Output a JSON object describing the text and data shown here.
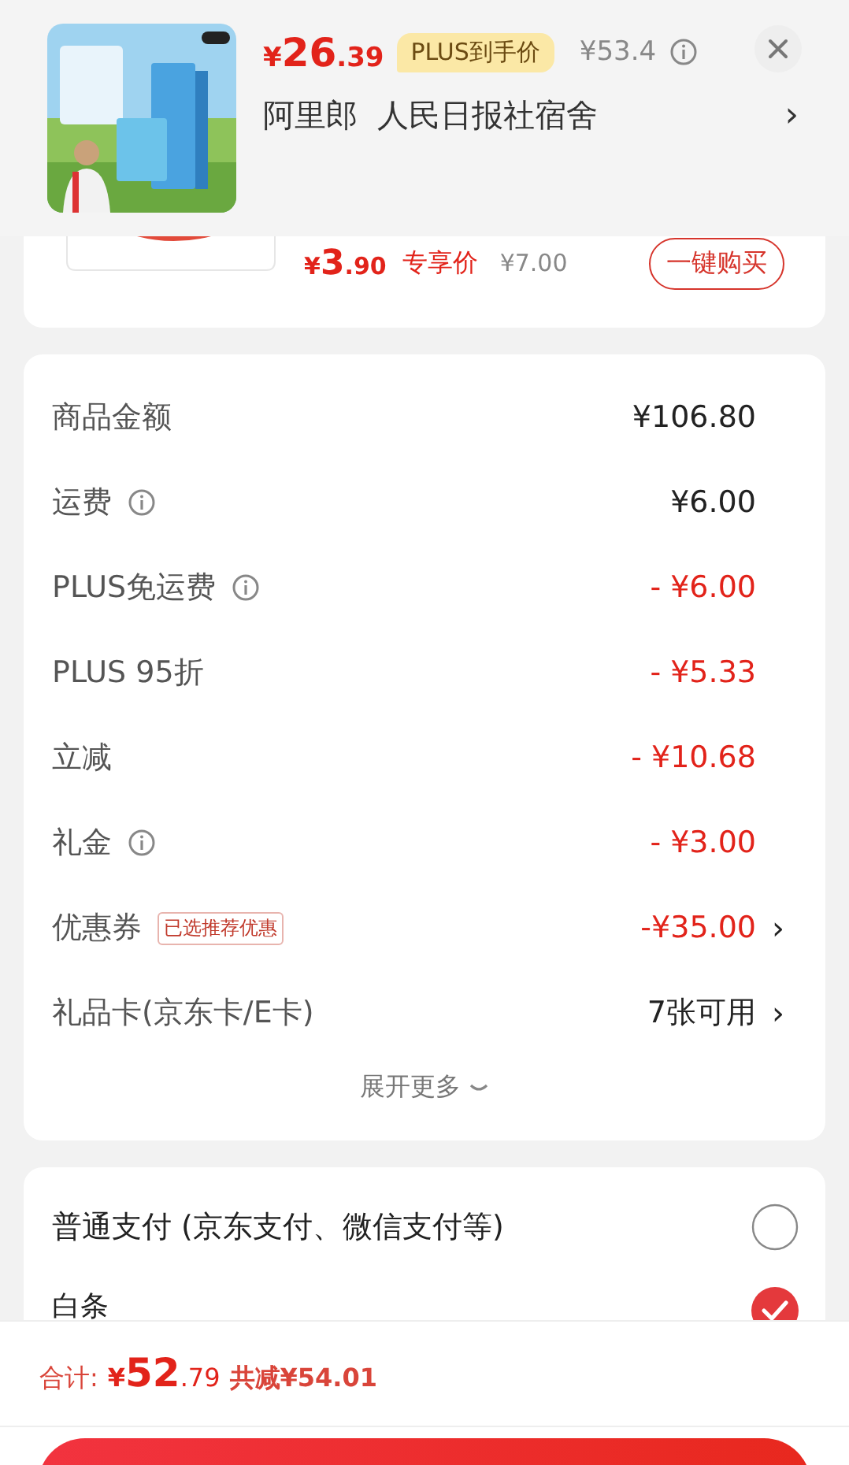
{
  "popup": {
    "price": {
      "symbol": "¥",
      "integer": "26",
      "decimal": ".39"
    },
    "badge": "PLUS到手价",
    "original_price": "¥53.4",
    "address": "阿里郎  人民日报社宿舍",
    "chevron": "›"
  },
  "deal": {
    "price": {
      "symbol": "¥",
      "integer": "3",
      "decimal": ".90"
    },
    "label": "专享价",
    "original_price": "¥7.00",
    "button": "一键购买"
  },
  "summary": {
    "rows": [
      {
        "label": "商品金额",
        "info": false,
        "value": "¥106.80",
        "kind": "plain"
      },
      {
        "label": "运费",
        "info": true,
        "value": "¥6.00",
        "kind": "plain"
      },
      {
        "label": "PLUS免运费",
        "info": true,
        "value": "- ¥6.00",
        "kind": "discount"
      },
      {
        "label": "PLUS 95折",
        "info": false,
        "value": "- ¥5.33",
        "kind": "discount"
      },
      {
        "label": "立减",
        "info": false,
        "value": "- ¥10.68",
        "kind": "discount"
      },
      {
        "label": "礼金",
        "info": true,
        "value": "- ¥3.00",
        "kind": "discount"
      },
      {
        "label": "优惠券",
        "info": false,
        "tag": "已选推荐优惠",
        "value": "-¥35.00",
        "kind": "discount",
        "chevron": "›"
      },
      {
        "label": "礼品卡(京东卡/E卡)",
        "info": false,
        "value": "7张可用",
        "kind": "plain",
        "chevron": "›"
      }
    ],
    "expand": "展开更多"
  },
  "payments": [
    {
      "label": "普通支付 (京东支付、微信支付等)",
      "selected": false
    },
    {
      "label": "白条",
      "selected": true
    }
  ],
  "footer": {
    "label": "合计:",
    "total": {
      "symbol": "¥",
      "integer": "52",
      "decimal": ".79"
    },
    "saving": "共减¥54.01"
  }
}
